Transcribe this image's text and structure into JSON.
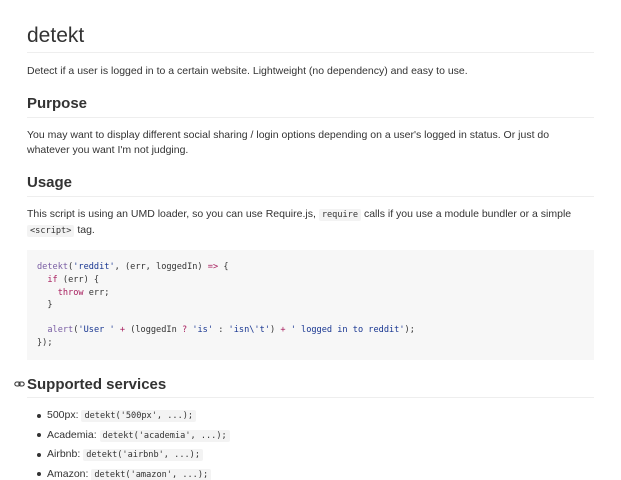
{
  "title": "detekt",
  "intro": "Detect if a user is logged in to a certain website. Lightweight (no dependency) and easy to use.",
  "purpose": {
    "heading": "Purpose",
    "text": "You may want to display different social sharing / login options depending on a user's logged in status. Or just do whatever you want I'm not judging."
  },
  "usage": {
    "heading": "Usage",
    "text_before": "This script is using an UMD loader, so you can use Require.js,",
    "code1": "require",
    "text_middle": "calls if you use a module bundler or a simple",
    "code2": "<script>",
    "text_after": "tag.",
    "code_lines": [
      [
        {
          "t": "fn",
          "v": "detekt"
        },
        {
          "t": "plain",
          "v": "("
        },
        {
          "t": "str",
          "v": "'reddit'"
        },
        {
          "t": "plain",
          "v": ", (err, loggedIn) "
        },
        {
          "t": "op",
          "v": "=>"
        },
        {
          "t": "plain",
          "v": " {"
        }
      ],
      [
        {
          "t": "plain",
          "v": "  "
        },
        {
          "t": "kw",
          "v": "if"
        },
        {
          "t": "plain",
          "v": " (err) {"
        }
      ],
      [
        {
          "t": "plain",
          "v": "    "
        },
        {
          "t": "kw",
          "v": "throw"
        },
        {
          "t": "plain",
          "v": " err;"
        }
      ],
      [
        {
          "t": "plain",
          "v": "  }"
        }
      ],
      [
        {
          "t": "plain",
          "v": ""
        }
      ],
      [
        {
          "t": "plain",
          "v": "  "
        },
        {
          "t": "fn",
          "v": "alert"
        },
        {
          "t": "plain",
          "v": "("
        },
        {
          "t": "str",
          "v": "'User '"
        },
        {
          "t": "plain",
          "v": " "
        },
        {
          "t": "op",
          "v": "+"
        },
        {
          "t": "plain",
          "v": " (loggedIn "
        },
        {
          "t": "op",
          "v": "?"
        },
        {
          "t": "plain",
          "v": " "
        },
        {
          "t": "str",
          "v": "'is'"
        },
        {
          "t": "plain",
          "v": " : "
        },
        {
          "t": "str",
          "v": "'isn\\'t'"
        },
        {
          "t": "plain",
          "v": ") "
        },
        {
          "t": "op",
          "v": "+"
        },
        {
          "t": "plain",
          "v": " "
        },
        {
          "t": "str",
          "v": "' logged in to reddit'"
        },
        {
          "t": "plain",
          "v": ");"
        }
      ],
      [
        {
          "t": "plain",
          "v": "});"
        }
      ]
    ]
  },
  "services": {
    "heading": "Supported services",
    "items": [
      {
        "name": "500px:",
        "code": "detekt('500px', ...);"
      },
      {
        "name": "Academia:",
        "code": "detekt('academia', ...);"
      },
      {
        "name": "Airbnb:",
        "code": "detekt('airbnb', ...);"
      },
      {
        "name": "Amazon:",
        "code": "detekt('amazon', ...);"
      }
    ]
  },
  "icons": {
    "anchor": "link-icon"
  },
  "colors": {
    "text": "#333333",
    "code_bg": "#f7f7f7",
    "string": "#183691",
    "keyword": "#a71d5d",
    "function": "#795da3",
    "rule": "#eeeeee"
  }
}
